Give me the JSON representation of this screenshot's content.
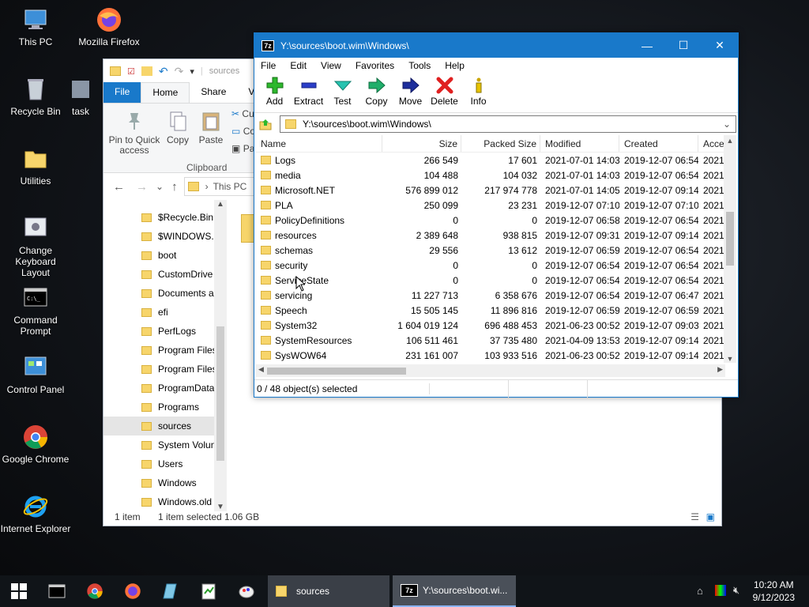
{
  "desktop": {
    "icons": [
      {
        "label": "This PC"
      },
      {
        "label": "Mozilla Firefox"
      },
      {
        "label": "Recycle Bin"
      },
      {
        "label": "task"
      },
      {
        "label": "Utilities"
      },
      {
        "label": "Change Keyboard Layout"
      },
      {
        "label": "Command Prompt"
      },
      {
        "label": "Control Panel"
      },
      {
        "label": "Google Chrome"
      },
      {
        "label": "Internet Explorer"
      }
    ]
  },
  "explorer": {
    "qat_path": "sources",
    "tabs": {
      "file": "File",
      "home": "Home",
      "share": "Share",
      "view": "V"
    },
    "ribbon": {
      "pin_label": "Pin to Quick access",
      "copy_label": "Copy",
      "paste_label": "Paste",
      "cut_label": "Cu",
      "copy_path_label": "Co",
      "paste_shortcut_label": "Pa",
      "group_label": "Clipboard"
    },
    "address": "This PC",
    "nav_items": [
      "$Recycle.Bin",
      "$WINDOWS.~",
      "boot",
      "CustomDrive",
      "Documents a",
      "efi",
      "PerfLogs",
      "Program Files",
      "Program Files",
      "ProgramData",
      "Programs",
      "sources",
      "System Volun",
      "Users",
      "Windows",
      "Windows.old"
    ],
    "status": {
      "count": "1 item",
      "selected": "1 item selected  1.06 GB"
    }
  },
  "sevenzip": {
    "title": "Y:\\sources\\boot.wim\\Windows\\",
    "logo": "7z",
    "menu": [
      "File",
      "Edit",
      "View",
      "Favorites",
      "Tools",
      "Help"
    ],
    "toolbar": [
      "Add",
      "Extract",
      "Test",
      "Copy",
      "Move",
      "Delete",
      "Info"
    ],
    "address": "Y:\\sources\\boot.wim\\Windows\\",
    "columns": [
      "Name",
      "Size",
      "Packed Size",
      "Modified",
      "Created",
      "Acce"
    ],
    "rows": [
      {
        "name": "Logs",
        "size": "266 549",
        "packed": "17 601",
        "modified": "2021-07-01 14:03",
        "created": "2019-12-07 06:54",
        "accessed": "2021-"
      },
      {
        "name": "media",
        "size": "104 488",
        "packed": "104 032",
        "modified": "2021-07-01 14:03",
        "created": "2019-12-07 06:54",
        "accessed": "2021-"
      },
      {
        "name": "Microsoft.NET",
        "size": "576 899 012",
        "packed": "217 974 778",
        "modified": "2021-07-01 14:05",
        "created": "2019-12-07 09:14",
        "accessed": "2021-"
      },
      {
        "name": "PLA",
        "size": "250 099",
        "packed": "23 231",
        "modified": "2019-12-07 07:10",
        "created": "2019-12-07 07:10",
        "accessed": "2021-"
      },
      {
        "name": "PolicyDefinitions",
        "size": "0",
        "packed": "0",
        "modified": "2019-12-07 06:58",
        "created": "2019-12-07 06:54",
        "accessed": "2021-"
      },
      {
        "name": "resources",
        "size": "2 389 648",
        "packed": "938 815",
        "modified": "2019-12-07 09:31",
        "created": "2019-12-07 09:14",
        "accessed": "2021-"
      },
      {
        "name": "schemas",
        "size": "29 556",
        "packed": "13 612",
        "modified": "2019-12-07 06:59",
        "created": "2019-12-07 06:54",
        "accessed": "2021-"
      },
      {
        "name": "security",
        "size": "0",
        "packed": "0",
        "modified": "2019-12-07 06:54",
        "created": "2019-12-07 06:54",
        "accessed": "2021-"
      },
      {
        "name": "ServiceState",
        "size": "0",
        "packed": "0",
        "modified": "2019-12-07 06:54",
        "created": "2019-12-07 06:54",
        "accessed": "2021-"
      },
      {
        "name": "servicing",
        "size": "11 227 713",
        "packed": "6 358 676",
        "modified": "2019-12-07 06:54",
        "created": "2019-12-07 06:47",
        "accessed": "2021-"
      },
      {
        "name": "Speech",
        "size": "15 505 145",
        "packed": "11 896 816",
        "modified": "2019-12-07 06:59",
        "created": "2019-12-07 06:59",
        "accessed": "2021-"
      },
      {
        "name": "System32",
        "size": "1 604 019 124",
        "packed": "696 488 453",
        "modified": "2021-06-23 00:52",
        "created": "2019-12-07 09:03",
        "accessed": "2021-"
      },
      {
        "name": "SystemResources",
        "size": "106 511 461",
        "packed": "37 735 480",
        "modified": "2021-04-09 13:53",
        "created": "2019-12-07 09:14",
        "accessed": "2021-"
      },
      {
        "name": "SysWOW64",
        "size": "231 161 007",
        "packed": "103 933 516",
        "modified": "2021-06-23 00:52",
        "created": "2019-12-07 09:14",
        "accessed": "2021-"
      }
    ],
    "status": "0 / 48 object(s) selected"
  },
  "taskbar": {
    "sources_label": "sources",
    "sevenzip_label": "Y:\\sources\\boot.wi...",
    "time": "10:20 AM",
    "date": "9/12/2023"
  }
}
